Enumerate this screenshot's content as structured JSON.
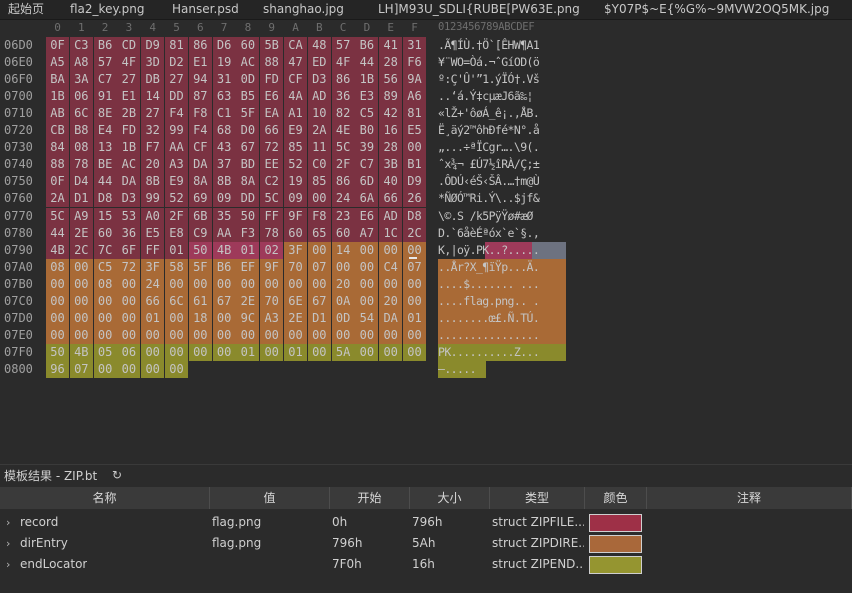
{
  "tabs": [
    {
      "label": "起始页"
    },
    {
      "label": "fla2_key.png"
    },
    {
      "label": "Hanser.psd"
    },
    {
      "label": "shanghao.jpg"
    },
    {
      "label": "LH]M93U_SDLI{RUBE[PW63E.png"
    },
    {
      "label": "$Y07P$~E{%G%~9MVW2OQ5MK.jpg"
    }
  ],
  "hex": {
    "col_headers": [
      "0",
      "1",
      "2",
      "3",
      "4",
      "5",
      "6",
      "7",
      "8",
      "9",
      "A",
      "B",
      "C",
      "D",
      "E",
      "F"
    ],
    "ascii_header": "0123456789ABCDEF",
    "rows": [
      {
        "offset": "06D0",
        "bytes": [
          "0F",
          "C3",
          "B6",
          "CD",
          "D9",
          "81",
          "86",
          "D6",
          "60",
          "5B",
          "CA",
          "48",
          "57",
          "B6",
          "41",
          "31"
        ],
        "ascii": ".Ã¶ÍÙ.†Ö`[ÊHW¶A1"
      },
      {
        "offset": "06E0",
        "bytes": [
          "A5",
          "A8",
          "57",
          "4F",
          "3D",
          "D2",
          "E1",
          "19",
          "AC",
          "88",
          "47",
          "ED",
          "4F",
          "44",
          "28",
          "F6"
        ],
        "ascii": "¥¨WO=Òá.¬ˆGíOD(ö"
      },
      {
        "offset": "06F0",
        "bytes": [
          "BA",
          "3A",
          "C7",
          "27",
          "DB",
          "27",
          "94",
          "31",
          "0D",
          "FD",
          "CF",
          "D3",
          "86",
          "1B",
          "56",
          "9A"
        ],
        "ascii": "º:Ç'Û'”1.ýÏÓ†.Vš"
      },
      {
        "offset": "0700",
        "bytes": [
          "1B",
          "06",
          "91",
          "E1",
          "14",
          "DD",
          "87",
          "63",
          "B5",
          "E6",
          "4A",
          "AD",
          "36",
          "E3",
          "89",
          "A6"
        ],
        "ascii": "..‘á.Ý‡cµæJ­6ã‰¦"
      },
      {
        "offset": "0710",
        "bytes": [
          "AB",
          "6C",
          "8E",
          "2B",
          "27",
          "F4",
          "F8",
          "C1",
          "5F",
          "EA",
          "A1",
          "10",
          "82",
          "C5",
          "42",
          "81"
        ],
        "ascii": "«lŽ+'ôøÁ_ê¡.‚ÅB."
      },
      {
        "offset": "0720",
        "bytes": [
          "CB",
          "B8",
          "E4",
          "FD",
          "32",
          "99",
          "F4",
          "68",
          "D0",
          "66",
          "E9",
          "2A",
          "4E",
          "B0",
          "16",
          "E5"
        ],
        "ascii": "Ë¸äý2™ôhÐfé*N°.å"
      },
      {
        "offset": "0730",
        "bytes": [
          "84",
          "08",
          "13",
          "1B",
          "F7",
          "AA",
          "CF",
          "43",
          "67",
          "72",
          "85",
          "11",
          "5C",
          "39",
          "28",
          "00"
        ],
        "ascii": "„...÷ªÏCgr….\\9(."
      },
      {
        "offset": "0740",
        "bytes": [
          "88",
          "78",
          "BE",
          "AC",
          "20",
          "A3",
          "DA",
          "37",
          "BD",
          "EE",
          "52",
          "C0",
          "2F",
          "C7",
          "3B",
          "B1"
        ],
        "ascii": "ˆx¾¬ £Ú7½îRÀ/Ç;±"
      },
      {
        "offset": "0750",
        "bytes": [
          "0F",
          "D4",
          "44",
          "DA",
          "8B",
          "E9",
          "8A",
          "8B",
          "8A",
          "C2",
          "19",
          "85",
          "86",
          "6D",
          "40",
          "D9"
        ],
        "ascii": ".ÔDÚ‹éŠ‹ŠÂ.…†m@Ù"
      },
      {
        "offset": "0760",
        "bytes": [
          "2A",
          "D1",
          "D8",
          "D3",
          "99",
          "52",
          "69",
          "09",
          "DD",
          "5C",
          "09",
          "00",
          "24",
          "6A",
          "66",
          "26"
        ],
        "ascii": "*ÑØÓ™Ri.Ý\\..$jf&"
      },
      {
        "offset": "0770",
        "bytes": [
          "5C",
          "A9",
          "15",
          "53",
          "A0",
          "2F",
          "6B",
          "35",
          "50",
          "FF",
          "9F",
          "F8",
          "23",
          "E6",
          "AD",
          "D8"
        ],
        "ascii": "\\©.S /k5PÿŸø#æ­Ø"
      },
      {
        "offset": "0780",
        "bytes": [
          "44",
          "2E",
          "60",
          "36",
          "E5",
          "E8",
          "C9",
          "AA",
          "F3",
          "78",
          "60",
          "65",
          "60",
          "A7",
          "1C",
          "2C"
        ],
        "ascii": "D.`6åèÉªóx`e`§.,"
      },
      {
        "offset": "0790",
        "bytes": [
          "4B",
          "2C",
          "7C",
          "6F",
          "FF",
          "01",
          "50",
          "4B",
          "01",
          "02",
          "3F",
          "00",
          "14",
          "00",
          "00",
          "00"
        ],
        "ascii": "K,|oÿ.PK..?....."
      },
      {
        "offset": "07A0",
        "bytes": [
          "08",
          "00",
          "C5",
          "72",
          "3F",
          "58",
          "5F",
          "B6",
          "EF",
          "9F",
          "70",
          "07",
          "00",
          "00",
          "C4",
          "07"
        ],
        "ascii": "..År?X_¶ïŸp...Ä."
      },
      {
        "offset": "07B0",
        "bytes": [
          "00",
          "00",
          "08",
          "00",
          "24",
          "00",
          "00",
          "00",
          "00",
          "00",
          "00",
          "00",
          "20",
          "00",
          "00",
          "00"
        ],
        "ascii": "....$....... ..."
      },
      {
        "offset": "07C0",
        "bytes": [
          "00",
          "00",
          "00",
          "00",
          "66",
          "6C",
          "61",
          "67",
          "2E",
          "70",
          "6E",
          "67",
          "0A",
          "00",
          "20",
          "00"
        ],
        "ascii": "....flag.png.. ."
      },
      {
        "offset": "07D0",
        "bytes": [
          "00",
          "00",
          "00",
          "00",
          "01",
          "00",
          "18",
          "00",
          "9C",
          "A3",
          "2E",
          "D1",
          "0D",
          "54",
          "DA",
          "01"
        ],
        "ascii": "........œ£.Ñ.TÚ."
      },
      {
        "offset": "07E0",
        "bytes": [
          "00",
          "00",
          "00",
          "00",
          "00",
          "00",
          "00",
          "00",
          "00",
          "00",
          "00",
          "00",
          "00",
          "00",
          "00",
          "00"
        ],
        "ascii": "................"
      },
      {
        "offset": "07F0",
        "bytes": [
          "50",
          "4B",
          "05",
          "06",
          "00",
          "00",
          "00",
          "00",
          "01",
          "00",
          "01",
          "00",
          "5A",
          "00",
          "00",
          "00"
        ],
        "ascii": "PK..........Z..."
      },
      {
        "offset": "0800",
        "bytes": [
          "96",
          "07",
          "00",
          "00",
          "00",
          "00"
        ],
        "ascii": "–....."
      }
    ]
  },
  "results": {
    "title": "模板结果 - ZIP.bt",
    "columns": [
      "名称",
      "值",
      "开始",
      "大小",
      "类型",
      "颜色",
      "注释"
    ],
    "rows": [
      {
        "name": "record",
        "value": "flag.png",
        "start": "0h",
        "size": "796h",
        "type": "struct ZIPFILE...",
        "color": "#9e3047"
      },
      {
        "name": "dirEntry",
        "value": "flag.png",
        "start": "796h",
        "size": "5Ah",
        "type": "struct ZIPDIRE...",
        "color": "#a9683a"
      },
      {
        "name": "endLocator",
        "value": "",
        "start": "7F0h",
        "size": "16h",
        "type": "struct ZIPEND...",
        "color": "#959530"
      }
    ]
  },
  "colors": {
    "record": "#7b3242",
    "record_sel": "#9e3a5a",
    "dirEntry": "#a96a36",
    "endLocator": "#8a8a2c",
    "selection": "#555555",
    "dirEntry_ascii_sel": "#6d7280"
  }
}
